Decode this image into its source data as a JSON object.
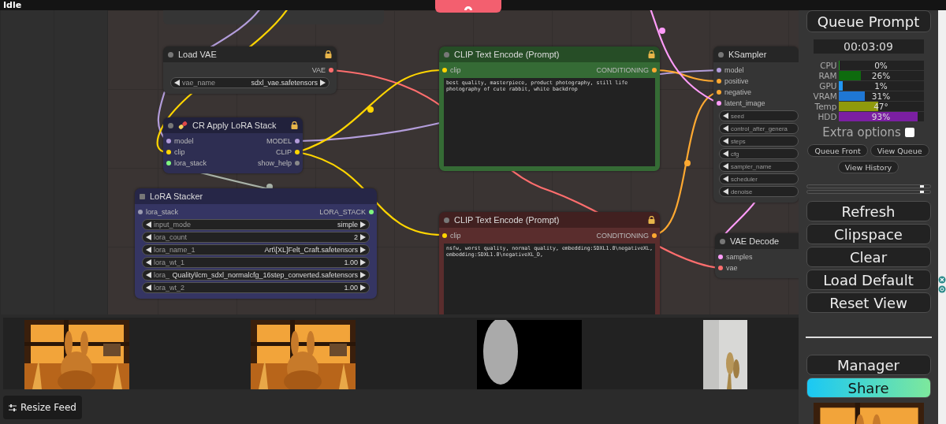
{
  "status": "Idle",
  "nodes": [
    {
      "kind": "plain",
      "title": "Load VAE",
      "muted": false,
      "locked": true,
      "color": "#353535",
      "outputs": [
        {
          "label": "VAE",
          "color": "#ff6e6e"
        }
      ],
      "widgets": [
        {
          "label": "vae_name",
          "value": "sdxl_vae.safetensors"
        }
      ]
    },
    {
      "kind": "plain",
      "title": "CR Apply LoRA Stack",
      "icon": true,
      "muted": false,
      "locked": true,
      "color": "#2e2e52",
      "inputs": [
        {
          "label": "model",
          "color": "#b39ddb"
        },
        {
          "label": "clip",
          "color": "#ffd500"
        },
        {
          "label": "lora_stack",
          "color": "#7ff57f"
        }
      ],
      "outputs": [
        {
          "label": "MODEL",
          "color": "#b39ddb"
        },
        {
          "label": "CLIP",
          "color": "#ffd500"
        },
        {
          "label": "show_help",
          "color": "#8a8a8a"
        }
      ]
    },
    {
      "kind": "plain",
      "title": "LoRA Stacker",
      "muted": true,
      "locked": false,
      "color": "#353563",
      "inputs": [
        {
          "label": "lora_stack",
          "color": "#9a9ab0"
        }
      ],
      "outputs": [
        {
          "label": "LORA_STACK",
          "color": "#7ff57f"
        }
      ],
      "widgets": [
        {
          "label": "input_mode",
          "value": "simple"
        },
        {
          "label": "lora_count",
          "value": "2"
        },
        {
          "label": "lora_name_1",
          "value": "Art\\[XL]Felt_Craft.safetensors"
        },
        {
          "label": "lora_wt_1",
          "value": "1.00"
        },
        {
          "label": "lora_",
          "value": "Quality\\lcm_sdxl_normalcfg_16step_converted.safetensors"
        },
        {
          "label": "lora_wt_2",
          "value": "1.00"
        }
      ]
    },
    {
      "kind": "text",
      "title": "CLIP Text Encode (Prompt)",
      "muted": false,
      "locked": true,
      "color": "#356b35",
      "inputs": [
        {
          "label": "clip",
          "color": "#ffd500"
        }
      ],
      "outputs": [
        {
          "label": "CONDITIONING",
          "color": "#ffa931"
        }
      ],
      "text": "best quality, masterpiece, product photography, still life photography of cute rabbit, white backdrop"
    },
    {
      "kind": "text",
      "title": "CLIP Text Encode (Prompt)",
      "muted": false,
      "locked": true,
      "color": "#5a2d2d",
      "inputs": [
        {
          "label": "clip",
          "color": "#ffd500"
        }
      ],
      "outputs": [
        {
          "label": "CONDITIONING",
          "color": "#ffa931"
        }
      ],
      "text": "nsfw, worst quality, normal quality, embedding:SDXL1.0\\negativeXL, embedding:SDXL1.0\\negativeXL_D,"
    },
    {
      "kind": "plain",
      "title": "KSampler",
      "muted": false,
      "locked": false,
      "color": "#353535",
      "inputs": [
        {
          "label": "model",
          "color": "#b39ddb"
        },
        {
          "label": "positive",
          "color": "#ffa931"
        },
        {
          "label": "negative",
          "color": "#ffa931"
        },
        {
          "label": "latent_image",
          "color": "#ff9cf9"
        }
      ],
      "widgets": [
        {
          "label": "seed"
        },
        {
          "label": "control_after_genera"
        },
        {
          "label": "steps"
        },
        {
          "label": "cfg"
        },
        {
          "label": "sampler_name"
        },
        {
          "label": "scheduler"
        },
        {
          "label": "denoise"
        }
      ]
    },
    {
      "kind": "plain",
      "title": "VAE Decode",
      "muted": false,
      "locked": false,
      "color": "#353535",
      "inputs": [
        {
          "label": "samples",
          "color": "#ff9cf9"
        },
        {
          "label": "vae",
          "color": "#ff6e6e"
        }
      ]
    }
  ],
  "resize_button": "Resize Feed",
  "panel": {
    "queue_button": "Queue Prompt",
    "timer": "00:03:09",
    "stats": [
      {
        "label": "CPU",
        "value": "0%",
        "level": 0.01,
        "color": "#1b9e1b"
      },
      {
        "label": "RAM",
        "value": "26%",
        "level": 0.26,
        "color": "#0e6b0e"
      },
      {
        "label": "GPU",
        "value": "1%",
        "level": 0.05,
        "color": "#2196f3"
      },
      {
        "label": "VRAM",
        "value": "31%",
        "level": 0.31,
        "color": "#1f77d4"
      },
      {
        "label": "Temp",
        "value": "47°",
        "level": 0.47,
        "color": "#8f9a0c"
      },
      {
        "label": "HDD",
        "value": "93%",
        "level": 0.93,
        "color": "#7b1fa2"
      }
    ],
    "extra_options": {
      "label": "Extra options",
      "checked": false
    },
    "small_buttons": [
      "Queue Front",
      "View Queue",
      "View History"
    ],
    "sliders": [
      {
        "level": 0.95
      },
      {
        "level": 0.95
      }
    ],
    "buttons": [
      "Refresh",
      "Clipspace",
      "Clear",
      "Load Default",
      "Reset View"
    ],
    "lower_buttons": [
      {
        "label": "Manager",
        "kind": "plain"
      },
      {
        "label": "Share",
        "kind": "gradient"
      }
    ]
  }
}
